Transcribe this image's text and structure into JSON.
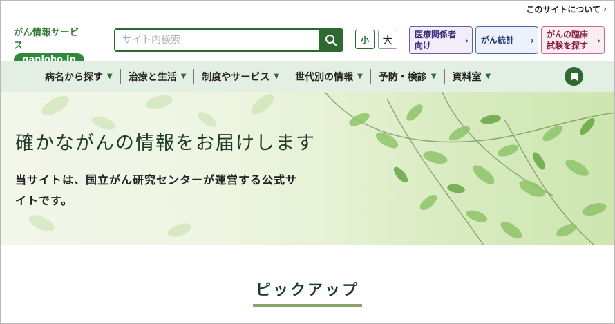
{
  "top": {
    "about_label": "このサイトについて"
  },
  "logo": {
    "title": "がん情報サービス",
    "url": "ganjoho.jp"
  },
  "search": {
    "placeholder": "サイト内検索",
    "value": ""
  },
  "font_size": {
    "small": "小",
    "large": "大"
  },
  "quick": {
    "medical": "医療関係者\n向け",
    "stats": "がん統計",
    "trial": "がんの臨床\n試験を探す"
  },
  "nav": {
    "items": [
      {
        "label": "病名から探す"
      },
      {
        "label": "治療と生活"
      },
      {
        "label": "制度やサービス"
      },
      {
        "label": "世代別の情報"
      },
      {
        "label": "予防・検診"
      },
      {
        "label": "資料室"
      }
    ]
  },
  "hero": {
    "title": "確かながんの情報をお届けします",
    "description": "当サイトは、国立がん研究センターが運営する公式サイトです。"
  },
  "pickup": {
    "title": "ピックアップ"
  },
  "colors": {
    "primary": "#2c6a32",
    "nav_bg": "#e3efe2",
    "medical": "#6d5aa8",
    "stats": "#4b68ad",
    "trial": "#c96988"
  },
  "icons": {
    "search": "search-icon",
    "bookmark": "bookmark-icon",
    "chevron": "chevron-down-icon"
  }
}
